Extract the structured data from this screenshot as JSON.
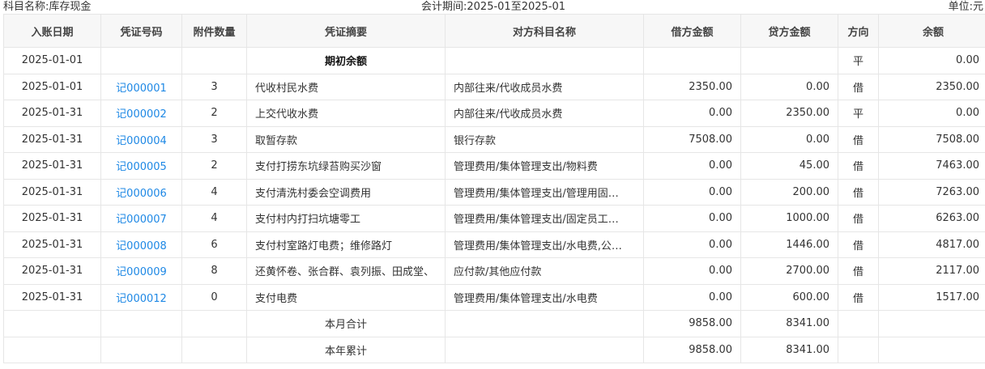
{
  "header": {
    "subject_label": "科目名称:库存现金",
    "period_label": "会计期间:2025-01至2025-01",
    "unit_label": "单位:元"
  },
  "table": {
    "columns": [
      "入账日期",
      "凭证号码",
      "附件数量",
      "凭证摘要",
      "对方科目名称",
      "借方金额",
      "贷方金额",
      "方向",
      "余额"
    ],
    "rows": [
      {
        "date": "2025-01-01",
        "voucher": "",
        "attachments": "",
        "summary": "期初余额",
        "counter_account": "",
        "debit": "",
        "credit": "",
        "direction": "平",
        "balance": "0.00"
      },
      {
        "date": "2025-01-01",
        "voucher": "记000001",
        "attachments": "3",
        "summary": "代收村民水费",
        "counter_account": "内部往来/代收成员水费",
        "debit": "2350.00",
        "credit": "0.00",
        "direction": "借",
        "balance": "2350.00"
      },
      {
        "date": "2025-01-31",
        "voucher": "记000002",
        "attachments": "2",
        "summary": "上交代收水费",
        "counter_account": "内部往来/代收成员水费",
        "debit": "0.00",
        "credit": "2350.00",
        "direction": "平",
        "balance": "0.00"
      },
      {
        "date": "2025-01-31",
        "voucher": "记000004",
        "attachments": "3",
        "summary": "取暂存款",
        "counter_account": "银行存款",
        "debit": "7508.00",
        "credit": "0.00",
        "direction": "借",
        "balance": "7508.00"
      },
      {
        "date": "2025-01-31",
        "voucher": "记000005",
        "attachments": "2",
        "summary": "支付打捞东坑绿苔购买沙窗",
        "counter_account": "管理费用/集体管理支出/物料费",
        "debit": "0.00",
        "credit": "45.00",
        "direction": "借",
        "balance": "7463.00"
      },
      {
        "date": "2025-01-31",
        "voucher": "记000006",
        "attachments": "4",
        "summary": "支付清洗村委会空调费用",
        "counter_account": "管理费用/集体管理支出/管理用固…",
        "debit": "0.00",
        "credit": "200.00",
        "direction": "借",
        "balance": "7263.00"
      },
      {
        "date": "2025-01-31",
        "voucher": "记000007",
        "attachments": "4",
        "summary": "支付村内打扫坑塘零工",
        "counter_account": "管理费用/集体管理支出/固定员工…",
        "debit": "0.00",
        "credit": "1000.00",
        "direction": "借",
        "balance": "6263.00"
      },
      {
        "date": "2025-01-31",
        "voucher": "记000008",
        "attachments": "6",
        "summary": "支付村室路灯电费；维修路灯",
        "counter_account": "管理费用/集体管理支出/水电费,公…",
        "debit": "0.00",
        "credit": "1446.00",
        "direction": "借",
        "balance": "4817.00"
      },
      {
        "date": "2025-01-31",
        "voucher": "记000009",
        "attachments": "8",
        "summary": "还黄怀卷、张合群、袁列振、田成堂、",
        "counter_account": "应付款/其他应付款",
        "debit": "0.00",
        "credit": "2700.00",
        "direction": "借",
        "balance": "2117.00"
      },
      {
        "date": "2025-01-31",
        "voucher": "记000012",
        "attachments": "0",
        "summary": "支付电费",
        "counter_account": "管理费用/集体管理支出/水电费",
        "debit": "0.00",
        "credit": "600.00",
        "direction": "借",
        "balance": "1517.00"
      }
    ],
    "totals": [
      {
        "label": "本月合计",
        "debit": "9858.00",
        "credit": "8341.00"
      },
      {
        "label": "本年累计",
        "debit": "9858.00",
        "credit": "8341.00"
      }
    ]
  }
}
